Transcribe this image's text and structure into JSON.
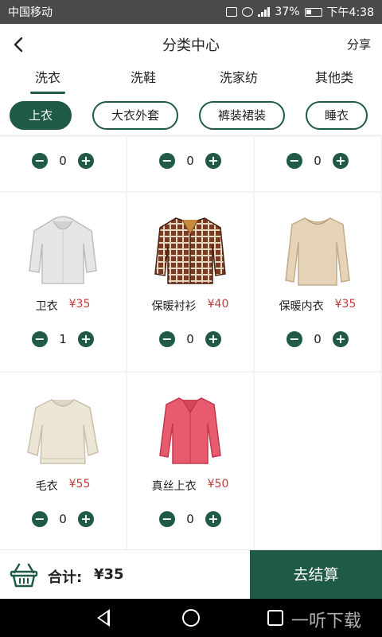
{
  "status": {
    "carrier": "中国移动",
    "battery": "37%",
    "time": "下午4:38"
  },
  "header": {
    "back_icon": "chevron-left-icon",
    "title": "分类中心",
    "share": "分享"
  },
  "tabs": [
    {
      "label": "洗衣",
      "active": true
    },
    {
      "label": "洗鞋",
      "active": false
    },
    {
      "label": "洗家纺",
      "active": false
    },
    {
      "label": "其他类",
      "active": false
    }
  ],
  "chips": [
    {
      "label": "上衣",
      "active": true
    },
    {
      "label": "大衣外套",
      "active": false
    },
    {
      "label": "裤装裙装",
      "active": false
    },
    {
      "label": "睡衣",
      "active": false
    }
  ],
  "top_row_qty": [
    "0",
    "0",
    "0"
  ],
  "products": [
    {
      "name": "卫衣",
      "price": "¥35",
      "qty": "1",
      "image": "hoodie-image"
    },
    {
      "name": "保暖衬衫",
      "price": "¥40",
      "qty": "0",
      "image": "plaid-shirt-image"
    },
    {
      "name": "保暖内衣",
      "price": "¥35",
      "qty": "0",
      "image": "thermal-top-image"
    },
    {
      "name": "毛衣",
      "price": "¥55",
      "qty": "0",
      "image": "sweater-image"
    },
    {
      "name": "真丝上衣",
      "price": "¥50",
      "qty": "0",
      "image": "silk-blouse-image"
    }
  ],
  "bottom": {
    "total_label": "合计:",
    "total_value": "¥35",
    "checkout": "去结算",
    "basket_icon": "basket-icon"
  },
  "watermark": "一听下载",
  "colors": {
    "accent": "#1e5a45",
    "price": "#c23b3b"
  }
}
